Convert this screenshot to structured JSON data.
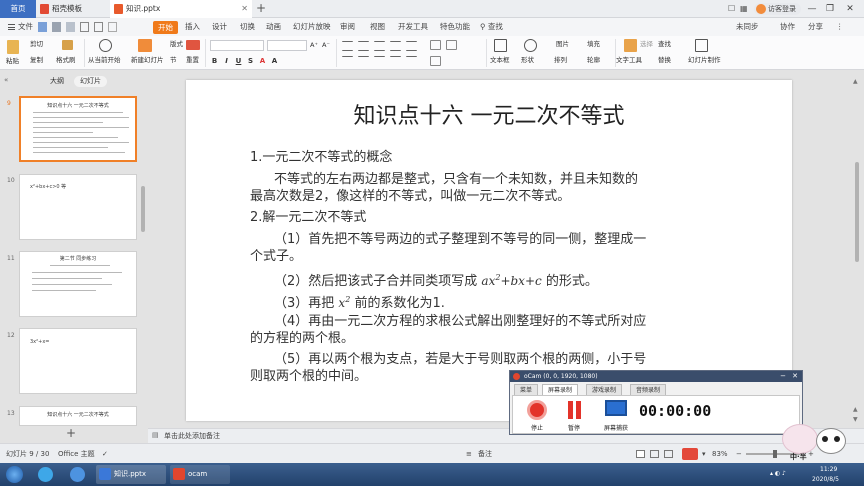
{
  "titlebar": {
    "home_tab": "首页",
    "tabs": [
      {
        "label": "稻壳模板",
        "color": "#e24a34"
      },
      {
        "label": "知识.pptx",
        "color": "#e85a2c"
      }
    ],
    "new_tab": "+",
    "user": "访客登录",
    "window_controls": [
      "—",
      "❐",
      "✕"
    ]
  },
  "menubar": {
    "file": "文件",
    "items": [
      "开始",
      "插入",
      "设计",
      "切换",
      "动画",
      "幻灯片放映",
      "审阅",
      "视图",
      "开发工具",
      "特色功能"
    ],
    "search": "查找",
    "right": [
      "未同步",
      "协作",
      "分享"
    ]
  },
  "toolbar": {
    "paste": "粘贴",
    "cut": "剪切",
    "copy": "复制",
    "format_painter": "格式刷",
    "from_current": "从当前开始",
    "new_slide": "新建幻灯片",
    "layout": "版式",
    "section": "节",
    "reset": "重置",
    "font_size_up": "A⁺",
    "font_size_down": "A⁻",
    "textbox": "文本框",
    "shape": "形状",
    "arrange": "排列",
    "outline": "轮廓",
    "picture": "图片",
    "fill": "填充",
    "find": "查找",
    "replace": "替换",
    "select": "选择",
    "text_tool": "文字工具",
    "slide_production": "幻灯片制作"
  },
  "leftpane": {
    "tab_outline": "大纲",
    "tab_slides": "幻灯片",
    "add_slide": "+",
    "slides": [
      {
        "num": "9",
        "title": "知识点十六   一元二次不等式",
        "active": true
      },
      {
        "num": "10",
        "title": "x²+bx+c>0 等",
        "active": false
      },
      {
        "num": "11",
        "title": "第二节 同步练习",
        "active": false
      },
      {
        "num": "12",
        "title": "3x²+x=",
        "active": false
      },
      {
        "num": "13",
        "title": "知识点十六  一元二次不等式",
        "active": false
      }
    ]
  },
  "slide": {
    "title": "知识点十六      一元二次不等式",
    "h1": "1.一元二次不等式的概念",
    "p1_line1": "不等式的左右两边都是整式，只含有一个未知数，并且未知数的",
    "p1_line2": "最高次数是2，像这样的不等式，叫做一元二次不等式。",
    "h2": "2.解一元二次不等式",
    "s1_line1": "（1）首先把不等号两边的式子整理到不等号的同一侧，整理成一",
    "s1_line2": "个式子。",
    "s2_pre": "（2）然后把该式子合并同类项写成",
    "s2_math": "ax²+bx+c",
    "s2_post": "的形式。",
    "s3_pre": "（3）再把",
    "s3_math": "x²",
    "s3_post": "前的系数化为1.",
    "s4_line1": "（4）再由一元二次方程的求根公式解出刚整理好的不等式所对应",
    "s4_line2": "的方程的两个根。",
    "s5_line1": "（5）再以两个根为支点，若是大于号则取两个根的两侧，小于号",
    "s5_line2": "则取两个根的中间。"
  },
  "notes": {
    "placeholder": "单击此处添加备注"
  },
  "statusbar": {
    "slide_counter": "幻灯片 9 / 30",
    "theme": "Office 主题",
    "notes_btn": "备注",
    "zoom_label": "83%",
    "zoom_value": 0.5
  },
  "ocam": {
    "title": "oCam (0, 0, 1920, 1080)",
    "tabs": [
      "菜单",
      "屏幕录制",
      "游戏录制",
      "音频录制"
    ],
    "active_tab": 1,
    "stop_label": "停止",
    "pause_label": "暂停",
    "screen_label": "屏幕捕获",
    "timer": "00:00:00"
  },
  "mascot": {
    "text": "中·半"
  },
  "taskbar": {
    "tasks": [
      {
        "label": "知识.pptx",
        "color": "#3b78d8"
      },
      {
        "label": "ocam",
        "color": "#e2462e"
      }
    ],
    "time": "11:29",
    "date": "2020/8/5"
  }
}
